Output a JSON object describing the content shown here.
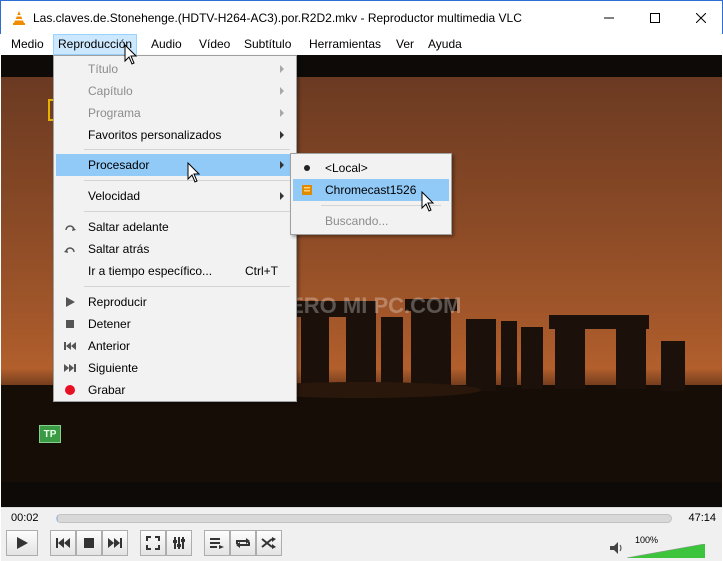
{
  "window": {
    "title": "Las.claves.de.Stonehenge.(HDTV-H264-AC3).por.R2D2.mkv - Reproductor multimedia VLC",
    "buttons": [
      "minimize",
      "maximize",
      "close"
    ]
  },
  "menubar": {
    "items": [
      "Medio",
      "Reproducción",
      "Audio",
      "Vídeo",
      "Subtítulo",
      "Herramientas",
      "Ver",
      "Ayuda"
    ],
    "active": "Reproducción"
  },
  "playback_menu": {
    "items": [
      {
        "label": "Título",
        "disabled": true,
        "submenu": true
      },
      {
        "label": "Capítulo",
        "disabled": true,
        "submenu": true
      },
      {
        "label": "Programa",
        "disabled": true,
        "submenu": true
      },
      {
        "label": "Favoritos personalizados",
        "disabled": false,
        "submenu": true
      },
      {
        "label": "Procesador",
        "disabled": false,
        "submenu": true,
        "highlighted": true
      },
      {
        "label": "Velocidad",
        "disabled": false,
        "submenu": true
      },
      {
        "label": "Saltar adelante",
        "icon": "jump-forward-icon"
      },
      {
        "label": "Saltar atrás",
        "icon": "jump-backward-icon"
      },
      {
        "label": "Ir a tiempo específico...",
        "shortcut": "Ctrl+T"
      },
      {
        "label": "Reproducir",
        "icon": "play-icon"
      },
      {
        "label": "Detener",
        "icon": "stop-icon"
      },
      {
        "label": "Anterior",
        "icon": "previous-icon"
      },
      {
        "label": "Siguiente",
        "icon": "next-icon"
      },
      {
        "label": "Grabar",
        "icon": "record-icon"
      }
    ]
  },
  "renderer_submenu": {
    "items": [
      {
        "label": "<Local>",
        "selected": true
      },
      {
        "label": "Chromecast1526",
        "highlighted": true,
        "icon": "chromecast-icon"
      },
      {
        "label": "Buscando...",
        "disabled": true
      }
    ]
  },
  "video": {
    "badge": "TP",
    "watermark": "QUIERO MI PC.COM"
  },
  "controls": {
    "elapsed": "00:02",
    "total": "47:14",
    "progress": 0.001,
    "volume_label": "100%",
    "volume": 1.0,
    "buttons": [
      "play-icon",
      "previous-icon",
      "stop-icon",
      "next-icon",
      "fullscreen-icon",
      "extended-settings-icon",
      "playlist-icon",
      "loop-icon",
      "shuffle-icon"
    ]
  },
  "colors": {
    "accent": "#91c9f7",
    "menu_active": "#cce8ff",
    "vlc_orange": "#f08c00",
    "record_red": "#e81123",
    "volume_green": "#3cc43c"
  }
}
